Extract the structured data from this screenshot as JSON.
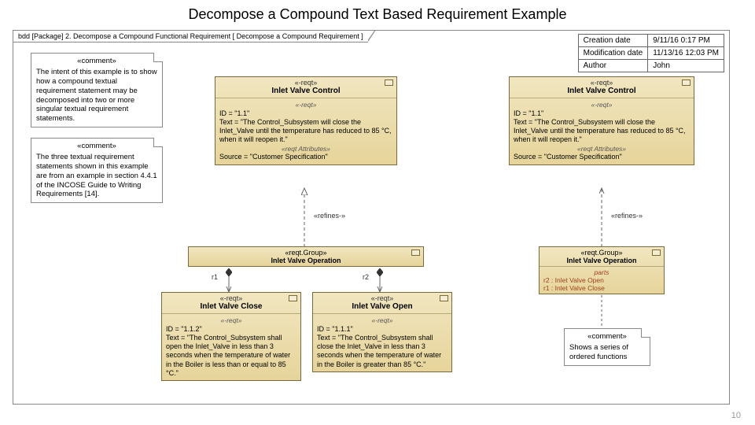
{
  "title": "Decompose a Compound Text Based Requirement Example",
  "frame_label": "bdd [Package] 2. Decompose a Compound Functional Requirement [ Decompose a Compound Requirement ]",
  "meta": {
    "r1k": "Creation date",
    "r1v": "9/11/16 0:17 PM",
    "r2k": "Modification date",
    "r2v": "11/13/16 12:03 PM",
    "r3k": "Author",
    "r3v": "John"
  },
  "comment1_stereo": "«comment»",
  "comment1_text": "The intent of this example is to show how a compound textual requirement statement may be decomposed into two or more singular textual requirement statements.",
  "comment2_stereo": "«comment»",
  "comment2_text": "The three textual requirement statements shown in this example are from an example in section 4.4.1 of the INCOSE Guide to Writing Requirements [14].",
  "comment3_stereo": "«comment»",
  "comment3_text": "Shows a series of ordered functions",
  "ivc1": {
    "stereo": "«-reqt»",
    "name": "Inlet Valve Control",
    "sub": "«-reqt»",
    "id": "ID = \"1.1\"",
    "text": "Text = \"The Control_Subsystem will close the Inlet_Valve until the temperature has reduced to 85 °C, when it will reopen it.\"",
    "attr_label": "«reqt Attributes»",
    "source": "Source = \"Customer Specification\""
  },
  "ivc2": {
    "stereo": "«-reqt»",
    "name": "Inlet Valve Control",
    "sub": "«-reqt»",
    "id": "ID = \"1.1\"",
    "text": "Text = \"The Control_Subsystem will close the Inlet_Valve until the temperature has reduced to 85 °C, when it will reopen it.\"",
    "attr_label": "«reqt Attributes»",
    "source": "Source = \"Customer Specification\""
  },
  "group1": {
    "stereo": "«reqt.Group»",
    "name": "Inlet Valve Operation"
  },
  "group2": {
    "stereo": "«reqt.Group»",
    "name": "Inlet Valve Operation",
    "parts_label": "parts",
    "p1": "r2 : Inlet Valve Open",
    "p2": "r1 : Inlet Valve Close"
  },
  "close": {
    "stereo": "«-reqt»",
    "name": "Inlet Valve Close",
    "sub": "«-reqt»",
    "id": "ID = \"1.1.2\"",
    "text": "Text = \"The Control_Subsystem shall open the Inlet_Valve in less than 3 seconds when the temperature of water in the Boiler is less than or equal to 85 °C.\""
  },
  "open": {
    "stereo": "«-reqt»",
    "name": "Inlet Valve Open",
    "sub": "«-reqt»",
    "id": "ID = \"1.1.1\"",
    "text": "Text = \"The Control_Subsystem shall close the Inlet_Valve in less than 3 seconds when the temperature of water in the Boiler is greater than 85 °C.\""
  },
  "labels": {
    "refines1": "«refines-»",
    "refines2": "«refines-»",
    "r1": "r1",
    "r2": "r2"
  },
  "pagenum": "10"
}
